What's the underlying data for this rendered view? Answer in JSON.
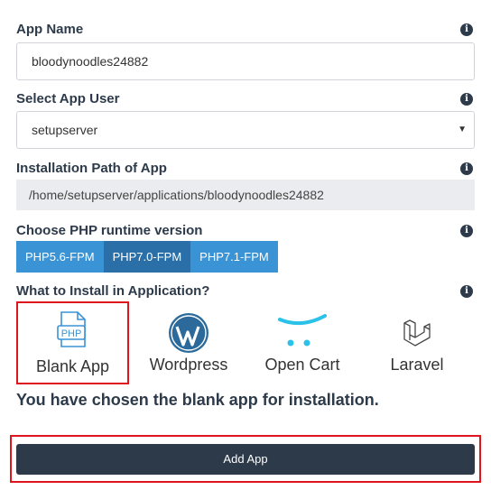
{
  "app_name": {
    "label": "App Name",
    "value": "bloodynoodles24882",
    "info_icon": "info-icon"
  },
  "app_user": {
    "label": "Select App User",
    "selected": "setupserver"
  },
  "install_path": {
    "label": "Installation Path of App",
    "value": "/home/setupserver/applications/bloodynoodles24882"
  },
  "php_runtime": {
    "label": "Choose PHP runtime version",
    "options": [
      "PHP5.6-FPM",
      "PHP7.0-FPM",
      "PHP7.1-FPM"
    ],
    "selected": "PHP7.0-FPM"
  },
  "install_type": {
    "label": "What to Install in Application?",
    "options": [
      {
        "label": "Blank App",
        "icon": "php-file-icon",
        "selected": true
      },
      {
        "label": "Wordpress",
        "icon": "wordpress-icon",
        "selected": false
      },
      {
        "label": "Open Cart",
        "icon": "shopping-cart-icon",
        "selected": false
      },
      {
        "label": "Laravel",
        "icon": "laravel-icon",
        "selected": false
      }
    ],
    "chosen_message": "You have chosen the blank app for installation."
  },
  "actions": {
    "add_label": "Add App"
  },
  "colors": {
    "primary_dark": "#2d3a4a",
    "segment_blue": "#3a93d5",
    "segment_active": "#2a6fa8",
    "highlight_red": "#e0141e"
  },
  "logo_texts": {
    "php_badge": "PHP"
  }
}
